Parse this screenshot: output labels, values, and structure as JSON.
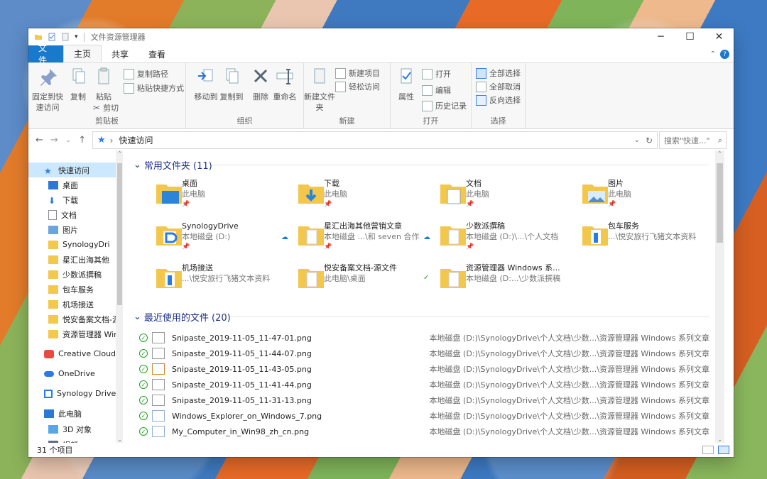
{
  "window": {
    "title": "文件资源管理器"
  },
  "menu": {
    "file": "文件",
    "home": "主页",
    "share": "共享",
    "view": "查看"
  },
  "ribbon": {
    "pin_label": "固定到快速访问",
    "copy": "复制",
    "paste": "粘贴",
    "copy_path": "复制路径",
    "paste_shortcut": "粘贴快捷方式",
    "cut": "剪切",
    "clipboard": "剪贴板",
    "move_to": "移动到",
    "copy_to": "复制到",
    "delete": "删除",
    "rename": "重命名",
    "organize": "组织",
    "new_folder": "新建文件夹",
    "new_item": "新建项目",
    "easy_access": "轻松访问",
    "new": "新建",
    "properties": "属性",
    "open_btn": "打开",
    "edit": "编辑",
    "history": "历史记录",
    "open": "打开",
    "select_all": "全部选择",
    "select_none": "全部取消",
    "invert_selection": "反向选择",
    "select": "选择"
  },
  "address": {
    "location": "快速访问",
    "search_placeholder": "搜索\"快速...\""
  },
  "nav": [
    "快速访问",
    "桌面",
    "下载",
    "文档",
    "图片",
    "SynologyDri",
    "星汇出海其他",
    "少数派撰稿",
    "包车服务",
    "机场接送",
    "悦安备案文档-源",
    "资源管理器 Win",
    "Creative Cloud F",
    "OneDrive",
    "Synology Drive -",
    "此电脑",
    "3D 对象",
    "视频"
  ],
  "frequent": {
    "header": "常用文件夹 (11)",
    "items": [
      {
        "name": "桌面",
        "sub": "此电脑"
      },
      {
        "name": "下载",
        "sub": "此电脑"
      },
      {
        "name": "文档",
        "sub": "此电脑"
      },
      {
        "name": "图片",
        "sub": "此电脑"
      },
      {
        "name": "SynologyDrive",
        "sub": "本地磁盘 (D:)"
      },
      {
        "name": "星汇出海其他营销文章",
        "sub": "本地磁盘 ...\\和 seven 合作"
      },
      {
        "name": "少数派撰稿",
        "sub": "本地磁盘 (D:)\\...\\个人文档"
      },
      {
        "name": "包车服务",
        "sub": "...\\悦安旅行飞猪文本资料"
      },
      {
        "name": "机场接送",
        "sub": "...\\悦安旅行飞猪文本资料"
      },
      {
        "name": "悦安备案文档-源文件",
        "sub": "此电脑\\桌面"
      },
      {
        "name": "资源管理器 Windows 系...",
        "sub": "本地磁盘 (D:...\\少数派撰稿"
      }
    ]
  },
  "recent": {
    "header": "最近使用的文件 (20)",
    "items": [
      {
        "name": "Snipaste_2019-11-05_11-47-01.png",
        "path": "本地磁盘 (D:)\\SynologyDrive\\个人文档\\少数...\\资源管理器 Windows 系列文章"
      },
      {
        "name": "Snipaste_2019-11-05_11-44-07.png",
        "path": "本地磁盘 (D:)\\SynologyDrive\\个人文档\\少数...\\资源管理器 Windows 系列文章"
      },
      {
        "name": "Snipaste_2019-11-05_11-43-05.png",
        "path": "本地磁盘 (D:)\\SynologyDrive\\个人文档\\少数...\\资源管理器 Windows 系列文章"
      },
      {
        "name": "Snipaste_2019-11-05_11-41-44.png",
        "path": "本地磁盘 (D:)\\SynologyDrive\\个人文档\\少数...\\资源管理器 Windows 系列文章"
      },
      {
        "name": "Snipaste_2019-11-05_11-31-13.png",
        "path": "本地磁盘 (D:)\\SynologyDrive\\个人文档\\少数...\\资源管理器 Windows 系列文章"
      },
      {
        "name": "Windows_Explorer_on_Windows_7.png",
        "path": "本地磁盘 (D:)\\SynologyDrive\\个人文档\\少数...\\资源管理器 Windows 系列文章"
      },
      {
        "name": "My_Computer_in_Win98_zh_cn.png",
        "path": "本地磁盘 (D:)\\SynologyDrive\\个人文档\\少数...\\资源管理器 Windows 系列文章"
      }
    ]
  },
  "statusbar": {
    "count": "31 个项目"
  }
}
